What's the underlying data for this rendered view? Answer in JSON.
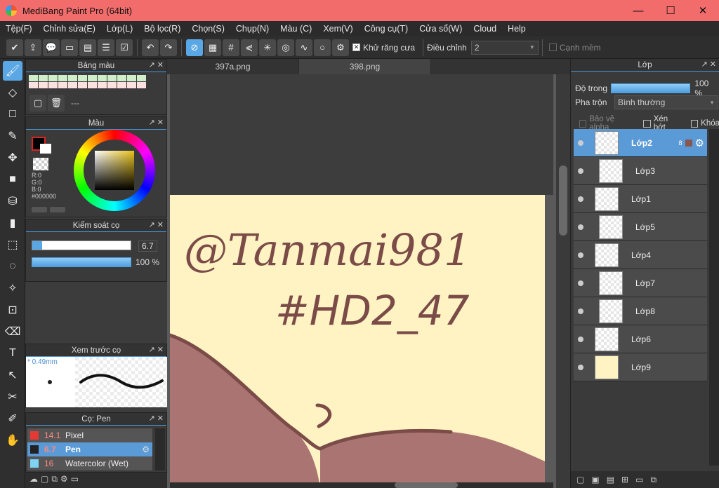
{
  "window": {
    "title": "MediBang Paint Pro (64bit)",
    "minimize": "—",
    "maximize": "☐",
    "close": "✕"
  },
  "menu": [
    "Tệp(F)",
    "Chỉnh sửa(E)",
    "Lớp(L)",
    "Bộ lọc(R)",
    "Chọn(S)",
    "Chụp(N)",
    "Màu (C)",
    "Xem(V)",
    "Công cụ(T)",
    "Cửa sổ(W)",
    "Cloud",
    "Help"
  ],
  "toolbar": {
    "antialias_label": "Khử răng cưa",
    "adjust_label": "Điều chỉnh",
    "adjust_value": "2",
    "soft_edge_label": "Cạnh mềm"
  },
  "palette_panel": {
    "title": "Bảng màu",
    "field_value": "---"
  },
  "color_panel": {
    "title": "Màu",
    "r": "R:0",
    "g": "G:0",
    "b": "B:0",
    "hex": "#000000",
    "fg_color": "#000000",
    "bg_color": "#ffffff"
  },
  "brush_control": {
    "title": "Kiểm soát cọ",
    "size_value": "6.7",
    "opacity_value": "100 %",
    "opacity_fraction": 1.0
  },
  "brush_preview": {
    "title": "Xem trước cọ",
    "size_label": "* 0.49mm"
  },
  "brush_list": {
    "title": "Cọ: Pen",
    "items": [
      {
        "size": "14.1",
        "name": "Pixel",
        "color": "#e53935"
      },
      {
        "size": "6.7",
        "name": "Pen",
        "color": "#222222"
      },
      {
        "size": "16",
        "name": "Watercolor (Wet)",
        "color": "#7fd3f5"
      }
    ]
  },
  "canvas": {
    "tabs": [
      "397a.png",
      "398.png"
    ],
    "active_tab": "398.png",
    "text_line1": "@Tanmai981",
    "text_line2": "#HD2_47"
  },
  "layers_panel": {
    "title": "Lớp",
    "opacity_label": "Độ trong",
    "opacity_value": "100 %",
    "blend_label": "Pha trộn",
    "blend_value": "Bình thường",
    "protect_alpha": "Bảo vệ alpha",
    "clipping": "Xén bớt",
    "lock": "Khóa",
    "selected_badge": "8",
    "layers": [
      {
        "name": "Lớp2",
        "selected": true
      },
      {
        "name": "Lớp3",
        "selected": false
      },
      {
        "name": "Lớp1",
        "selected": false
      },
      {
        "name": "Lớp5",
        "selected": false
      },
      {
        "name": "Lớp4",
        "selected": false
      },
      {
        "name": "Lớp7",
        "selected": false
      },
      {
        "name": "Lớp8",
        "selected": false
      },
      {
        "name": "Lớp6",
        "selected": false
      },
      {
        "name": "Lớp9",
        "selected": false
      }
    ]
  }
}
